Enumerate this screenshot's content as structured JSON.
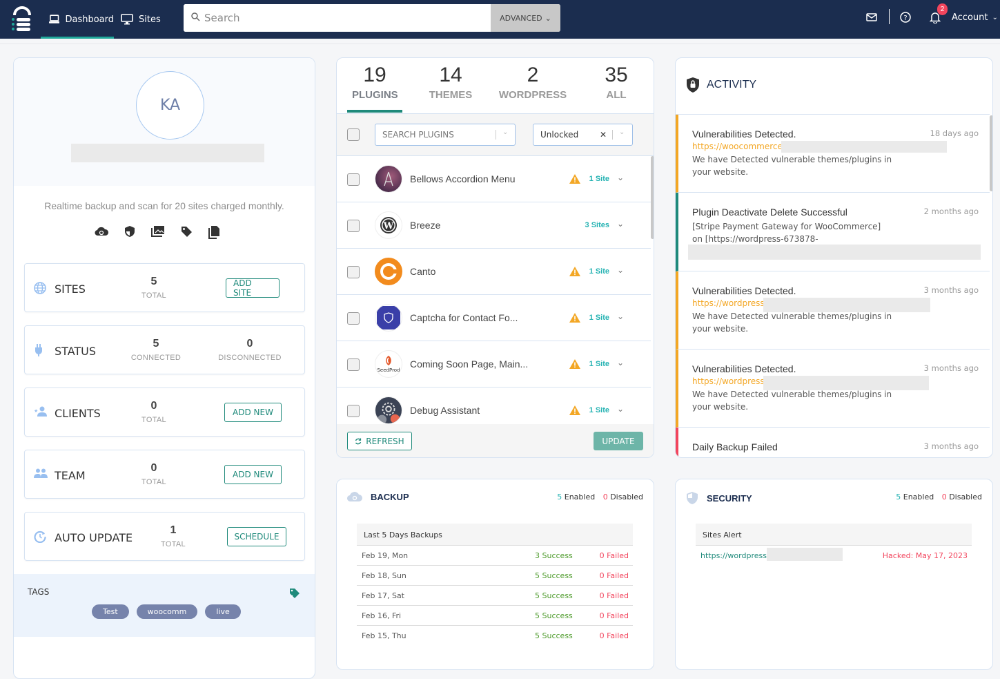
{
  "header": {
    "nav": [
      {
        "label": "Dashboard",
        "icon": "laptop-icon",
        "active": true
      },
      {
        "label": "Sites",
        "icon": "monitor-icon",
        "active": false
      }
    ],
    "search": {
      "placeholder": "Search",
      "value": ""
    },
    "advanced_label": "ADVANCED",
    "notification_count": "2",
    "account_label": "Account"
  },
  "profile": {
    "initials": "KA",
    "plan_text": "Realtime backup and scan for 20 sites charged monthly.",
    "feature_icons": [
      "cloud-sync-icon",
      "shield-icon",
      "images-icon",
      "tag-icon",
      "copy-icon"
    ]
  },
  "stats": {
    "sites": {
      "label": "SITES",
      "value": "5",
      "sub": "TOTAL",
      "button": "ADD SITE"
    },
    "status": {
      "label": "STATUS",
      "connected": "5",
      "connected_label": "CONNECTED",
      "disconnected": "0",
      "disconnected_label": "DISCONNECTED"
    },
    "clients": {
      "label": "CLIENTS",
      "value": "0",
      "sub": "TOTAL",
      "button": "ADD NEW"
    },
    "team": {
      "label": "TEAM",
      "value": "0",
      "sub": "TOTAL",
      "button": "ADD NEW"
    },
    "auto_update": {
      "label": "AUTO UPDATE",
      "value": "1",
      "sub": "TOTAL",
      "button": "SCHEDULE"
    }
  },
  "tags": {
    "title": "TAGS",
    "items": [
      "Test",
      "woocomm",
      "live"
    ]
  },
  "plugins_panel": {
    "tabs": [
      {
        "count": "19",
        "label": "PLUGINS",
        "active": true
      },
      {
        "count": "14",
        "label": "THEMES"
      },
      {
        "count": "2",
        "label": "WORDPRESS"
      },
      {
        "count": "35",
        "label": "ALL"
      }
    ],
    "search_placeholder": "SEARCH PLUGINS",
    "filter_value": "Unlocked",
    "items": [
      {
        "name": "Bellows Accordion Menu",
        "warning": true,
        "sites": "1 Site"
      },
      {
        "name": "Breeze",
        "warning": false,
        "sites": "3 Sites"
      },
      {
        "name": "Canto",
        "warning": true,
        "sites": "1 Site"
      },
      {
        "name": "Captcha for Contact Fo...",
        "warning": true,
        "sites": "1 Site"
      },
      {
        "name": "Coming Soon Page, Main...",
        "warning": true,
        "sites": "1 Site"
      },
      {
        "name": "Debug Assistant",
        "warning": true,
        "sites": "1 Site"
      }
    ],
    "refresh_label": "REFRESH",
    "update_label": "UPDATE"
  },
  "activity": {
    "title": "ACTIVITY",
    "items": [
      {
        "title": "Vulnerabilities Detected.",
        "time": "18 days ago",
        "link": "https://woocommerce-",
        "desc": "We have Detected vulnerable themes/plugins in your website.",
        "type": "warning"
      },
      {
        "title": "Plugin Deactivate Delete Successful",
        "time": "2 months ago",
        "desc": "[Stripe Payment Gateway for WooCommerce] on [https://wordpress-673878-",
        "type": "success"
      },
      {
        "title": "Vulnerabilities Detected.",
        "time": "3 months ago",
        "link": "https://wordpress-",
        "desc": "We have Detected vulnerable themes/plugins in your website.",
        "type": "warning"
      },
      {
        "title": "Vulnerabilities Detected.",
        "time": "3 months ago",
        "link": "https://wordpress-",
        "desc": "We have Detected vulnerable themes/plugins in your website.",
        "type": "warning"
      },
      {
        "title": "Daily Backup Failed",
        "time": "3 months ago",
        "type": "error"
      }
    ],
    "colors": {
      "warning": "#f3a725",
      "success": "#1f8a7b",
      "error": "#f2455d"
    }
  },
  "backup": {
    "title": "BACKUP",
    "enabled": "5",
    "enabled_label": "Enabled",
    "disabled": "0",
    "disabled_label": "Disabled",
    "table_title": "Last 5 Days Backups",
    "rows": [
      {
        "date": "Feb 19, Mon",
        "success": "3 Success",
        "failed": "0 Failed"
      },
      {
        "date": "Feb 18, Sun",
        "success": "5 Success",
        "failed": "0 Failed"
      },
      {
        "date": "Feb 17, Sat",
        "success": "5 Success",
        "failed": "0 Failed"
      },
      {
        "date": "Feb 16, Fri",
        "success": "5 Success",
        "failed": "0 Failed"
      },
      {
        "date": "Feb 15, Thu",
        "success": "5 Success",
        "failed": "0 Failed"
      }
    ]
  },
  "security": {
    "title": "SECURITY",
    "enabled": "5",
    "enabled_label": "Enabled",
    "disabled": "0",
    "disabled_label": "Disabled",
    "table_title": "Sites Alert",
    "alerts": [
      {
        "site": "https://wordpress-",
        "status": "Hacked: May 17, 2023"
      }
    ]
  }
}
